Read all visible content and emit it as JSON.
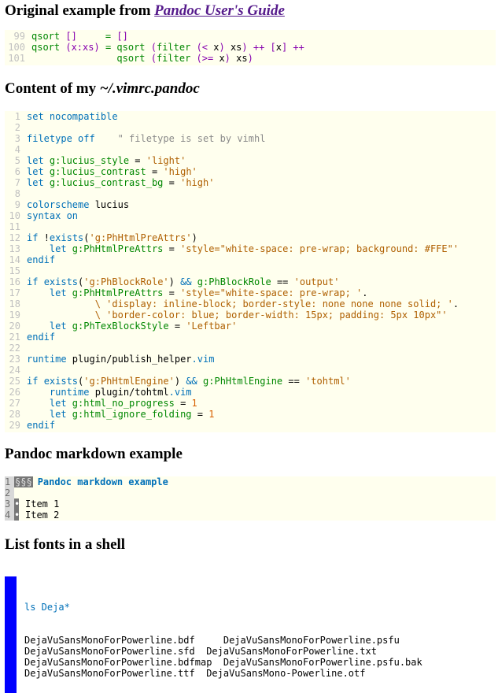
{
  "section1": {
    "title_prefix": "Original example from ",
    "title_link": "Pandoc User's Guide",
    "code": [
      {
        "n": "99",
        "parts": [
          {
            "t": "qsort ",
            "c": "grn"
          },
          {
            "t": "[]",
            "c": "op"
          },
          {
            "t": "     = ",
            "c": "grn"
          },
          {
            "t": "[]",
            "c": "op"
          }
        ]
      },
      {
        "n": "100",
        "parts": [
          {
            "t": "qsort ",
            "c": "grn"
          },
          {
            "t": "(x:xs)",
            "c": "op"
          },
          {
            "t": " = qsort ",
            "c": "grn"
          },
          {
            "t": "(",
            "c": "op"
          },
          {
            "t": "filter ",
            "c": "grn"
          },
          {
            "t": "(< ",
            "c": "op"
          },
          {
            "t": "x",
            "c": ""
          },
          {
            "t": ") ",
            "c": "op"
          },
          {
            "t": "xs",
            "c": ""
          },
          {
            "t": ") ++ [",
            "c": "op"
          },
          {
            "t": "x",
            "c": ""
          },
          {
            "t": "] ++",
            "c": "op"
          }
        ]
      },
      {
        "n": "101",
        "parts": [
          {
            "t": "               qsort ",
            "c": "grn"
          },
          {
            "t": "(",
            "c": "op"
          },
          {
            "t": "filter ",
            "c": "grn"
          },
          {
            "t": "(>= ",
            "c": "op"
          },
          {
            "t": "x",
            "c": ""
          },
          {
            "t": ") ",
            "c": "op"
          },
          {
            "t": "xs",
            "c": ""
          },
          {
            "t": ")",
            "c": "op"
          }
        ]
      }
    ]
  },
  "section2": {
    "title_prefix": "Content of my ",
    "title_em": "~/.vimrc.pandoc",
    "code": [
      {
        "n": "1",
        "parts": [
          {
            "t": "set nocompatible",
            "c": "kw"
          }
        ]
      },
      {
        "n": "2",
        "parts": []
      },
      {
        "n": "3",
        "parts": [
          {
            "t": "filetype off",
            "c": "kw"
          },
          {
            "t": "    \" filetype is set by vimhl",
            "c": "com"
          }
        ]
      },
      {
        "n": "4",
        "parts": []
      },
      {
        "n": "5",
        "parts": [
          {
            "t": "let ",
            "c": "kw"
          },
          {
            "t": "g:lucius_style",
            "c": "grn"
          },
          {
            "t": " = ",
            "c": ""
          },
          {
            "t": "'light'",
            "c": "str"
          }
        ]
      },
      {
        "n": "6",
        "parts": [
          {
            "t": "let ",
            "c": "kw"
          },
          {
            "t": "g:lucius_contrast",
            "c": "grn"
          },
          {
            "t": " = ",
            "c": ""
          },
          {
            "t": "'high'",
            "c": "str"
          }
        ]
      },
      {
        "n": "7",
        "parts": [
          {
            "t": "let ",
            "c": "kw"
          },
          {
            "t": "g:lucius_contrast_bg",
            "c": "grn"
          },
          {
            "t": " = ",
            "c": ""
          },
          {
            "t": "'high'",
            "c": "str"
          }
        ]
      },
      {
        "n": "8",
        "parts": []
      },
      {
        "n": "9",
        "parts": [
          {
            "t": "colorscheme ",
            "c": "kw"
          },
          {
            "t": "lucius",
            "c": ""
          }
        ]
      },
      {
        "n": "10",
        "parts": [
          {
            "t": "syntax on",
            "c": "kw"
          }
        ]
      },
      {
        "n": "11",
        "parts": []
      },
      {
        "n": "12",
        "parts": [
          {
            "t": "if ",
            "c": "kw"
          },
          {
            "t": "!",
            "c": ""
          },
          {
            "t": "exists",
            "c": "kw"
          },
          {
            "t": "(",
            "c": ""
          },
          {
            "t": "'g:PhHtmlPreAttrs'",
            "c": "str"
          },
          {
            "t": ")",
            "c": ""
          }
        ]
      },
      {
        "n": "13",
        "parts": [
          {
            "t": "    let ",
            "c": "kw"
          },
          {
            "t": "g:PhHtmlPreAttrs",
            "c": "grn"
          },
          {
            "t": " = ",
            "c": ""
          },
          {
            "t": "'style=\"white-space: pre-wrap; background: #FFE\"'",
            "c": "str"
          }
        ]
      },
      {
        "n": "14",
        "parts": [
          {
            "t": "endif",
            "c": "kw"
          }
        ]
      },
      {
        "n": "15",
        "parts": []
      },
      {
        "n": "16",
        "parts": [
          {
            "t": "if ",
            "c": "kw"
          },
          {
            "t": "exists",
            "c": "kw"
          },
          {
            "t": "(",
            "c": ""
          },
          {
            "t": "'g:PhBlockRole'",
            "c": "str"
          },
          {
            "t": ") ",
            "c": ""
          },
          {
            "t": "&&",
            "c": "kw"
          },
          {
            "t": " ",
            "c": ""
          },
          {
            "t": "g:PhBlockRole",
            "c": "grn"
          },
          {
            "t": " == ",
            "c": ""
          },
          {
            "t": "'output'",
            "c": "str"
          }
        ]
      },
      {
        "n": "17",
        "parts": [
          {
            "t": "    let ",
            "c": "kw"
          },
          {
            "t": "g:PhHtmlPreAttrs",
            "c": "grn"
          },
          {
            "t": " = ",
            "c": ""
          },
          {
            "t": "'style=\"white-space: pre-wrap; '",
            "c": "str"
          },
          {
            "t": ".",
            "c": ""
          }
        ]
      },
      {
        "n": "18",
        "parts": [
          {
            "t": "            \\ ",
            "c": "str"
          },
          {
            "t": "'display: inline-block; border-style: none none none solid; '",
            "c": "str"
          },
          {
            "t": ".",
            "c": ""
          }
        ]
      },
      {
        "n": "19",
        "parts": [
          {
            "t": "            \\ ",
            "c": "str"
          },
          {
            "t": "'border-color: blue; border-width: 15px; padding: 5px 10px\"'",
            "c": "str"
          }
        ]
      },
      {
        "n": "20",
        "parts": [
          {
            "t": "    let ",
            "c": "kw"
          },
          {
            "t": "g:PhTexBlockStyle",
            "c": "grn"
          },
          {
            "t": " = ",
            "c": ""
          },
          {
            "t": "'Leftbar'",
            "c": "str"
          }
        ]
      },
      {
        "n": "21",
        "parts": [
          {
            "t": "endif",
            "c": "kw"
          }
        ]
      },
      {
        "n": "22",
        "parts": []
      },
      {
        "n": "23",
        "parts": [
          {
            "t": "runtime ",
            "c": "kw"
          },
          {
            "t": "plugin/publish_helper",
            "c": ""
          },
          {
            "t": ".vim",
            "c": "kw"
          }
        ]
      },
      {
        "n": "24",
        "parts": []
      },
      {
        "n": "25",
        "parts": [
          {
            "t": "if ",
            "c": "kw"
          },
          {
            "t": "exists",
            "c": "kw"
          },
          {
            "t": "(",
            "c": ""
          },
          {
            "t": "'g:PhHtmlEngine'",
            "c": "str"
          },
          {
            "t": ") ",
            "c": ""
          },
          {
            "t": "&&",
            "c": "kw"
          },
          {
            "t": " ",
            "c": ""
          },
          {
            "t": "g:PhHtmlEngine",
            "c": "grn"
          },
          {
            "t": " == ",
            "c": ""
          },
          {
            "t": "'tohtml'",
            "c": "str"
          }
        ]
      },
      {
        "n": "26",
        "parts": [
          {
            "t": "    runtime ",
            "c": "kw"
          },
          {
            "t": "plugin/tohtml",
            "c": ""
          },
          {
            "t": ".vim",
            "c": "kw"
          }
        ]
      },
      {
        "n": "27",
        "parts": [
          {
            "t": "    let ",
            "c": "kw"
          },
          {
            "t": "g:html_no_progress",
            "c": "grn"
          },
          {
            "t": " = ",
            "c": ""
          },
          {
            "t": "1",
            "c": "num"
          }
        ]
      },
      {
        "n": "28",
        "parts": [
          {
            "t": "    let ",
            "c": "kw"
          },
          {
            "t": "g:html_ignore_folding",
            "c": "grn"
          },
          {
            "t": " = ",
            "c": ""
          },
          {
            "t": "1",
            "c": "num"
          }
        ]
      },
      {
        "n": "29",
        "parts": [
          {
            "t": "endif",
            "c": "kw"
          }
        ]
      }
    ]
  },
  "section3": {
    "title": "Pandoc markdown example",
    "code": [
      {
        "n": "1",
        "mark": "§§§",
        "text": "Pandoc markdown example",
        "kind": "hdr"
      },
      {
        "n": "2",
        "mark": "",
        "text": "",
        "kind": "blank"
      },
      {
        "n": "3",
        "mark": "•",
        "text": "Item 1",
        "kind": "item"
      },
      {
        "n": "4",
        "mark": "•",
        "text": "Item 2",
        "kind": "item"
      }
    ]
  },
  "section4": {
    "title": "List fonts in a shell",
    "command": "ls Deja*",
    "output": [
      "DejaVuSansMonoForPowerline.bdf     DejaVuSansMonoForPowerline.psfu",
      "DejaVuSansMonoForPowerline.sfd  DejaVuSansMonoForPowerline.txt",
      "DejaVuSansMonoForPowerline.bdfmap  DejaVuSansMonoForPowerline.psfu.bak",
      "DejaVuSansMonoForPowerline.ttf  DejaVuSansMono-Powerline.otf"
    ]
  },
  "colors": {
    "code_bg": "#ffffee",
    "keyword": "#0070b8",
    "identifier": "#008700",
    "string": "#af5f00",
    "shell_bar": "#0000ff"
  }
}
